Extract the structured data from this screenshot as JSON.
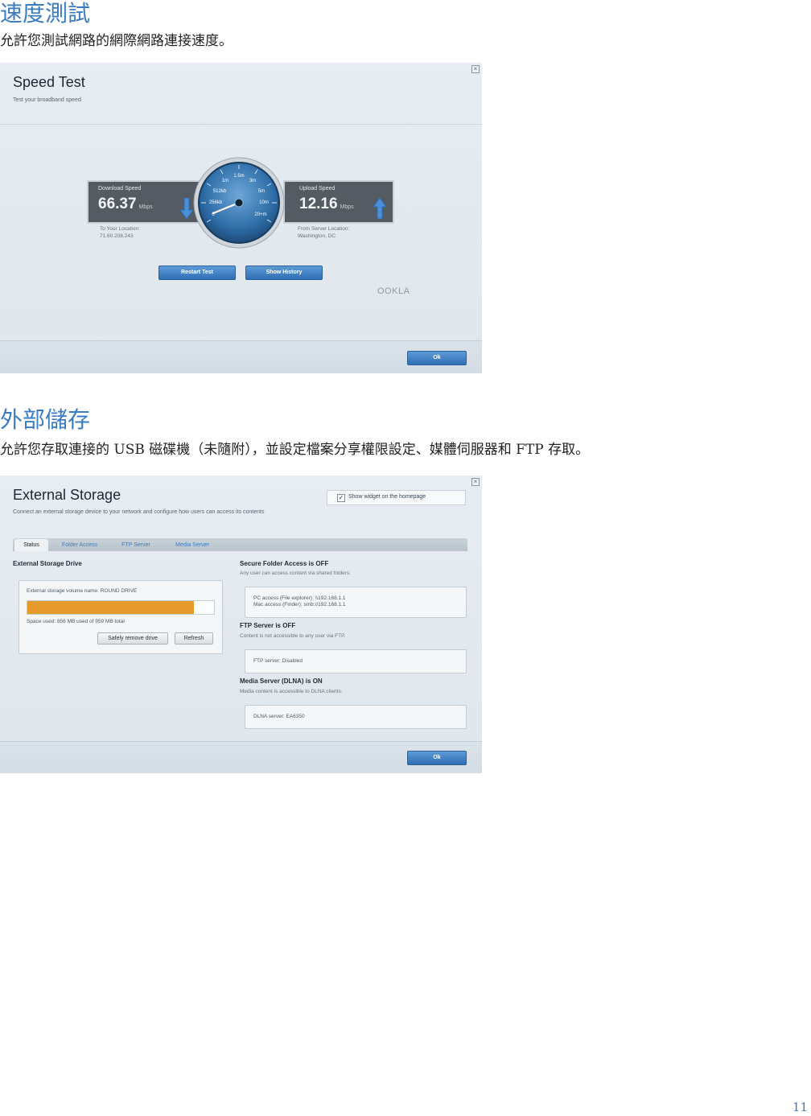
{
  "section1": {
    "heading": "速度測試",
    "paragraph": "允許您測試網路的網際網路連接速度。"
  },
  "speed_test": {
    "title": "Speed Test",
    "subtitle": "Test your broadband speed",
    "close_icon": "close-icon",
    "download": {
      "label": "Download Speed",
      "value": "66.37",
      "unit": "Mbps",
      "location_label": "To Your Location:",
      "location_value": "71.60.208.243"
    },
    "upload": {
      "label": "Upload Speed",
      "value": "12.16",
      "unit": "Mbps",
      "location_label": "From Server Location:",
      "location_value": "Washington, DC"
    },
    "gauge_ticks": [
      "1m",
      "1.5m",
      "3m",
      "512kb",
      "5m",
      "256kb",
      "10m",
      "0",
      "20+m"
    ],
    "restart_label": "Restart Test",
    "history_label": "Show History",
    "brand": "OOKLA",
    "ok_label": "Ok"
  },
  "section2": {
    "heading": "外部儲存",
    "paragraph": "允許您存取連接的 USB 磁碟機（未隨附），並設定檔案分享權限設定、媒體伺服器和 FTP 存取。"
  },
  "external_storage": {
    "title": "External Storage",
    "subtitle": "Connect an external storage device to your network and configure how users can access its contents",
    "show_widget_label": "Show widget on the homepage",
    "show_widget_checked": true,
    "tabs": [
      {
        "label": "Status"
      },
      {
        "label": "Folder Access"
      },
      {
        "label": "FTP Server"
      },
      {
        "label": "Media Server"
      }
    ],
    "drive_title": "External Storage Drive",
    "volume_name": "External storage volume name: ROUND DRIVE",
    "space_used": "Space used: 856 MB used of 959 MB total",
    "used_fraction": 0.8926,
    "safely_remove_label": "Safely remove drive",
    "refresh_label": "Refresh",
    "secure_title": "Secure Folder Access is OFF",
    "secure_desc": "Any user can access content via shared folders.",
    "pc_access": "PC access (File explorer): \\\\192.168.1.1",
    "mac_access": "Mac access (Finder): smb://192.168.1.1",
    "ftp_title": "FTP Server is OFF",
    "ftp_desc": "Content is not accessible to any user via FTP.",
    "ftp_server": "FTP server: Disabled",
    "media_title": "Media Server (DLNA) is ON",
    "media_desc": "Media content is accessible to DLNA clients.",
    "dlna_server": "DLNA server: EA6350",
    "ok_label": "Ok",
    "accent_color": "#e69a2c"
  },
  "page_number": "11"
}
